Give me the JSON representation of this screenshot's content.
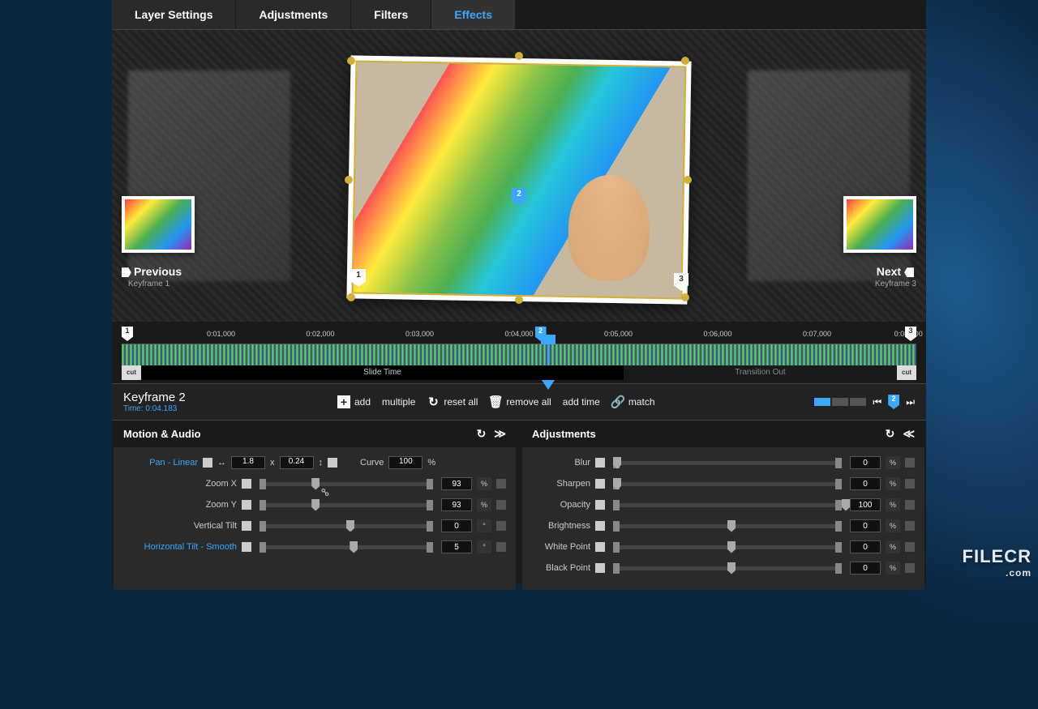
{
  "tabs": [
    "Layer Settings",
    "Adjustments",
    "Filters",
    "Effects"
  ],
  "active_tab": "Effects",
  "nav": {
    "prev_label": "Previous",
    "prev_sub": "Keyframe 1",
    "next_label": "Next",
    "next_sub": "Keyframe 3"
  },
  "timeline": {
    "ticks": [
      "0:01,000",
      "0:02,000",
      "0:03,000",
      "0:04,000",
      "0:05,000",
      "0:06,000",
      "0:07,000",
      "0:08,000"
    ],
    "cut": "cut",
    "slide_time": "Slide Time",
    "transition_out": "Transition Out",
    "keyframes": [
      {
        "n": "1",
        "pos": 0
      },
      {
        "n": "2",
        "pos": 52,
        "blue": true
      },
      {
        "n": "3",
        "pos": 100
      }
    ]
  },
  "kf_header": {
    "title": "Keyframe 2",
    "time": "Time: 0:04.183",
    "add": "add",
    "multiple": "multiple",
    "reset_all": "reset all",
    "remove_all": "remove all",
    "add_time": "add time",
    "match": "match",
    "current_kf": "2"
  },
  "panel_left": {
    "title": "Motion & Audio",
    "pan_label": "Pan - Linear",
    "pan_x": "1.8",
    "pan_x_prefix": "x",
    "pan_y": "0.24",
    "curve_label": "Curve",
    "curve_val": "100",
    "pct": "%",
    "deg": "°",
    "rows": [
      {
        "label": "Zoom X",
        "val": "93",
        "unit": "%",
        "thumb": 30
      },
      {
        "label": "Zoom Y",
        "val": "93",
        "unit": "%",
        "thumb": 30
      },
      {
        "label": "Vertical Tilt",
        "val": "0",
        "unit": "°",
        "thumb": 50
      },
      {
        "label": "Horizontal Tilt - Smooth",
        "val": "5",
        "unit": "°",
        "thumb": 52,
        "link": true
      }
    ]
  },
  "panel_right": {
    "title": "Adjustments",
    "rows": [
      {
        "label": "Blur",
        "val": "0",
        "unit": "%",
        "thumb": 0
      },
      {
        "label": "Sharpen",
        "val": "0",
        "unit": "%",
        "thumb": 0
      },
      {
        "label": "Opacity",
        "val": "100",
        "unit": "%",
        "thumb": 100
      },
      {
        "label": "Brightness",
        "val": "0",
        "unit": "%",
        "thumb": 50
      },
      {
        "label": "White Point",
        "val": "0",
        "unit": "%",
        "thumb": 50
      },
      {
        "label": "Black Point",
        "val": "0",
        "unit": "%",
        "thumb": 50
      }
    ]
  },
  "watermark": {
    "main": "FILECR",
    "sub": ".com"
  }
}
